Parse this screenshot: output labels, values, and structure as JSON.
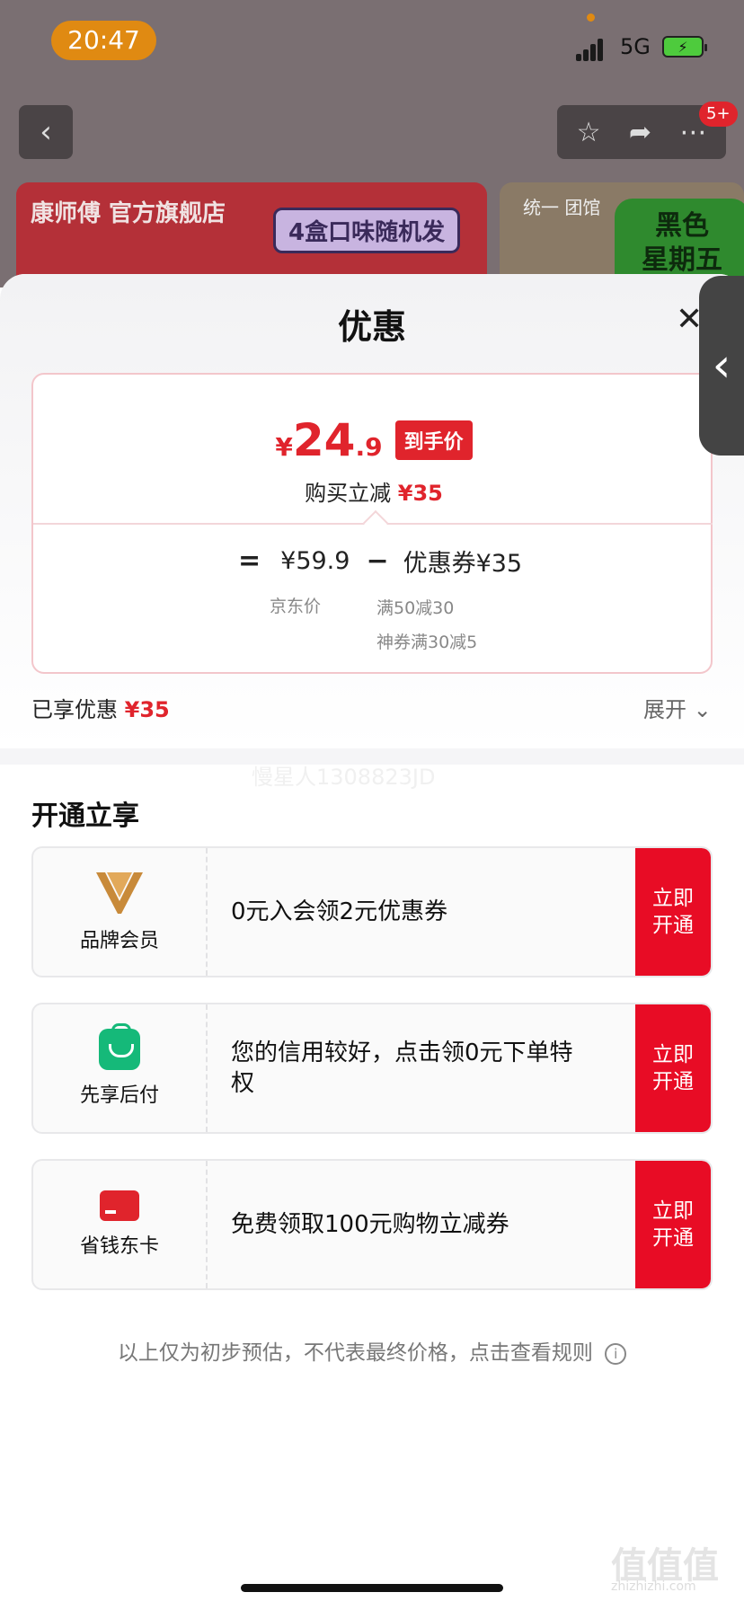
{
  "status_bar": {
    "time": "20:47",
    "network": "5G"
  },
  "nav": {
    "back_label": "‹",
    "message_badge": "5+"
  },
  "banners": {
    "main_brand": "康师傅 官方旗舰店",
    "main_tag": "4盒口味随机发",
    "side_shop": "统一 团馆",
    "side_promo_line1": "黑色",
    "side_promo_line2": "星期五"
  },
  "sheet": {
    "title": "优惠",
    "close_label": "✕",
    "price": {
      "yen": "¥",
      "integer": "24",
      "decimal": ".9",
      "tag": "到手价"
    },
    "buy_reduce": {
      "label": "购买立减",
      "amount": "¥35"
    },
    "formula": {
      "equals": "=",
      "jd_price": "¥59.9",
      "jd_price_label": "京东价",
      "minus": "−",
      "coupon": "优惠券¥35",
      "coupon_detail_1": "满50减30",
      "coupon_detail_2": "神券满30减5"
    },
    "enjoyed": {
      "label": "已享优惠",
      "amount": "¥35"
    },
    "expand_label": "展开",
    "watermark": "慢星人1308823JD",
    "open_title": "开通立享",
    "benefits": [
      {
        "icon": "brand-member-v-icon",
        "label": "品牌会员",
        "desc": "0元入会领2元优惠券",
        "button": "立即\n开通"
      },
      {
        "icon": "shopping-bag-icon",
        "label": "先享后付",
        "desc": "您的信用较好，点击领0元下单特权",
        "button": "立即\n开通"
      },
      {
        "icon": "card-icon",
        "label": "省钱东卡",
        "desc": "免费领取100元购物立减券",
        "button": "立即\n开通"
      }
    ],
    "disclaimer": "以上仅为初步预估，不代表最终价格，点击查看规则"
  },
  "corner_watermark": {
    "main": "值值值",
    "sub": "zhizhizhi.com"
  },
  "colors": {
    "accent_red": "#e0242c",
    "button_red": "#e80c25",
    "bag_green": "#15b979"
  }
}
